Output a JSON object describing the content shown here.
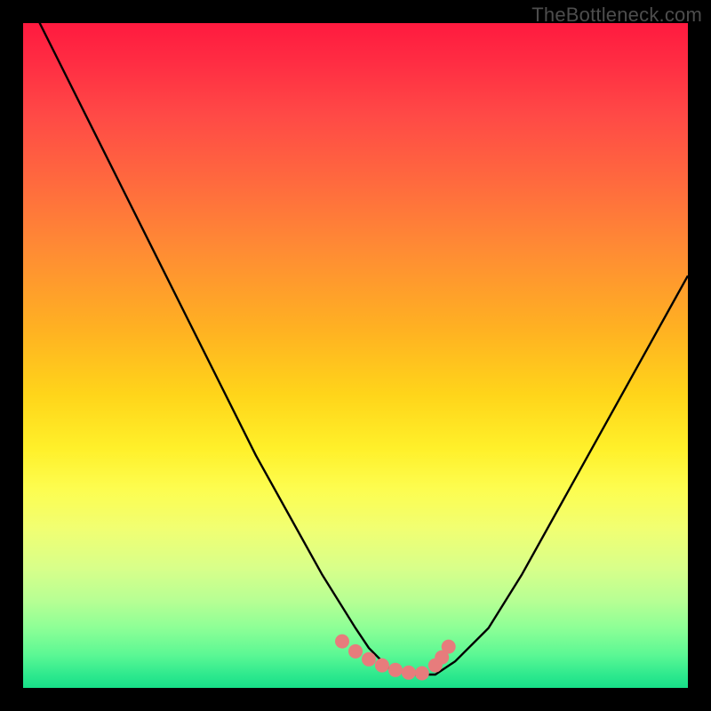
{
  "watermark": "TheBottleneck.com",
  "chart_data": {
    "type": "line",
    "title": "",
    "xlabel": "",
    "ylabel": "",
    "xlim": [
      0,
      100
    ],
    "ylim": [
      0,
      100
    ],
    "series": [
      {
        "name": "bottleneck-curve",
        "x": [
          0,
          5,
          10,
          15,
          20,
          25,
          30,
          35,
          40,
          45,
          50,
          52,
          55,
          58,
          60,
          62,
          65,
          70,
          75,
          80,
          85,
          90,
          95,
          100
        ],
        "y": [
          105,
          95,
          85,
          75,
          65,
          55,
          45,
          35,
          26,
          17,
          9,
          6,
          3,
          2,
          2,
          2,
          4,
          9,
          17,
          26,
          35,
          44,
          53,
          62
        ]
      }
    ],
    "markers": {
      "name": "highlight-points",
      "x": [
        48,
        50,
        52,
        54,
        56,
        58,
        60,
        62,
        63,
        64
      ],
      "y": [
        7.0,
        5.5,
        4.3,
        3.4,
        2.7,
        2.3,
        2.2,
        3.4,
        4.6,
        6.2
      ]
    },
    "colors": {
      "curve": "#000000",
      "markers": "#e77c7c",
      "gradient_top": "#ff1a3f",
      "gradient_bottom": "#17df88"
    }
  }
}
